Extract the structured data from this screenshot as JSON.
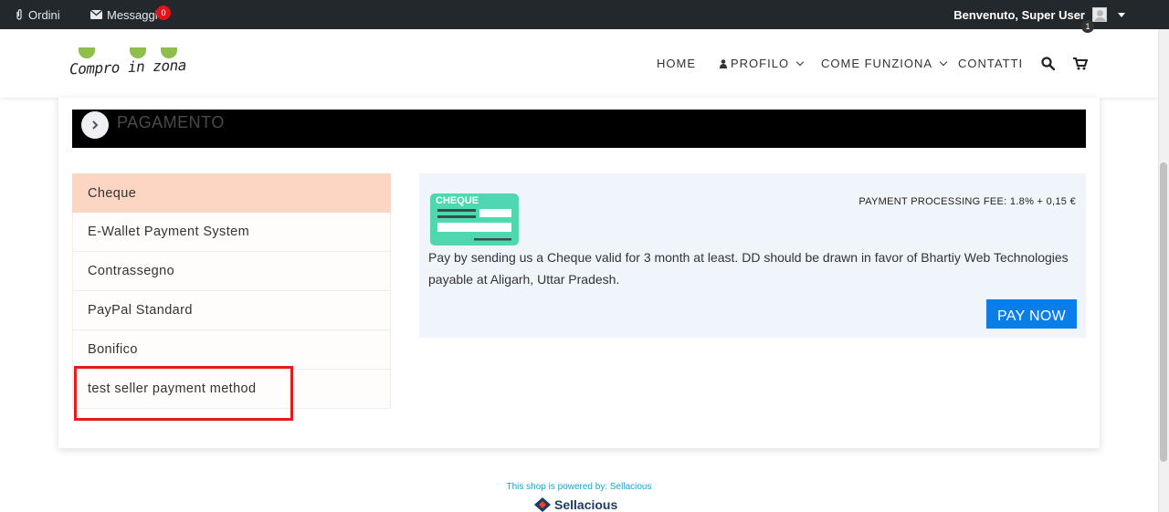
{
  "topbar": {
    "orders_label": "Ordini",
    "messages_label": "Messaggi",
    "messages_count": "0",
    "welcome_label": "Benvenuto, Super User"
  },
  "header": {
    "logo_text": "Compro in zona",
    "nav": {
      "home": "HOME",
      "profile": "PROFILO",
      "how_it_works": "COME FUNZIONA",
      "contacts": "CONTATTI"
    },
    "cart_count": "1"
  },
  "checkout": {
    "step_title": "PAGAMENTO",
    "methods": [
      {
        "label": "Cheque",
        "active": true
      },
      {
        "label": "E-Wallet Payment System",
        "active": false
      },
      {
        "label": "Contrassegno",
        "active": false
      },
      {
        "label": "PayPal Standard",
        "active": false
      },
      {
        "label": "Bonifico",
        "active": false
      },
      {
        "label": "test seller payment method",
        "active": false
      }
    ],
    "detail": {
      "icon_label": "CHEQUE",
      "fee_text": "PAYMENT PROCESSING FEE:  1.8% + 0,15 €",
      "description": "Pay by sending us a Cheque valid for 3 month at least. DD should be drawn in favor of Bhartiy Web Technologies payable at Aligarh, Uttar Pradesh.",
      "pay_button": "PAY NOW"
    }
  },
  "footer": {
    "powered_by": "This shop is powered by: Sellacious",
    "brand": "Sellacious"
  },
  "colors": {
    "active_method": "#fcd5c3",
    "pay_button": "#0a7ee8",
    "cheque_icon": "#4fd8b0",
    "highlight": "#e81b1b"
  }
}
